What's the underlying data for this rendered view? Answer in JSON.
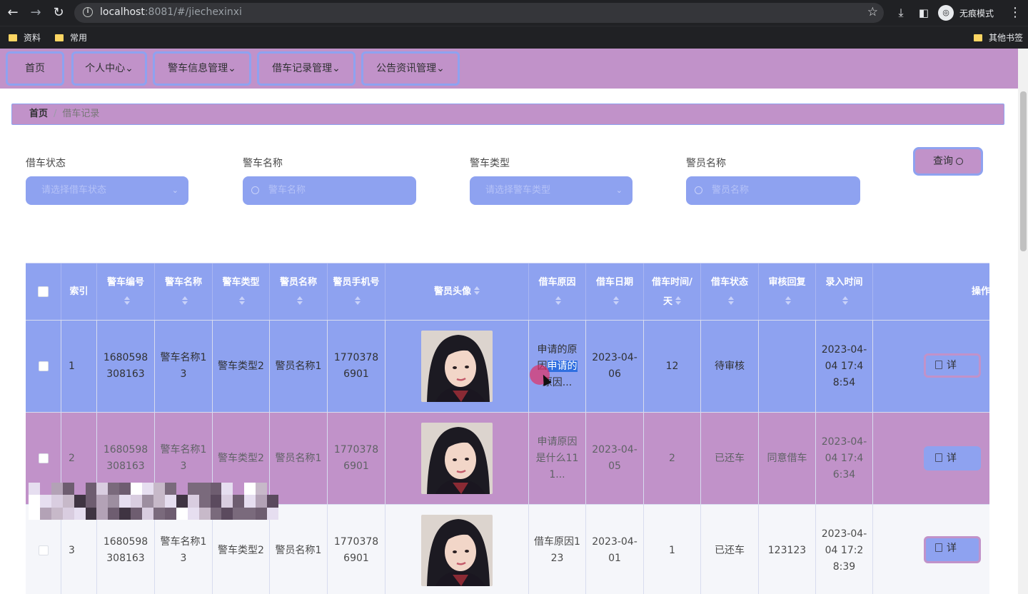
{
  "browser": {
    "url_host": "localhost",
    "url_rest": ":8081/#/jiechexinxi",
    "incognito_label": "无痕模式",
    "bookmarks": [
      "资料",
      "常用"
    ],
    "other_bookmarks": "其他书签"
  },
  "nav": {
    "items": [
      {
        "label": "首页"
      },
      {
        "label": "个人中心",
        "chevron": "⌄"
      },
      {
        "label": "警车信息管理",
        "chevron": "⌄"
      },
      {
        "label": "借车记录管理",
        "chevron": "⌄"
      },
      {
        "label": "公告资讯管理",
        "chevron": "⌄"
      }
    ]
  },
  "breadcrumb": {
    "home": "首页",
    "separator": "/",
    "current": "借车记录"
  },
  "filters": {
    "status": {
      "label": "借车状态",
      "placeholder": "请选择借车状态"
    },
    "car_name": {
      "label": "警车名称",
      "placeholder": "警车名称"
    },
    "car_type": {
      "label": "警车类型",
      "placeholder": "请选择警车类型"
    },
    "officer_name": {
      "label": "警员名称",
      "placeholder": "警员名称"
    },
    "query_label": "查询"
  },
  "table": {
    "headers": [
      "索引",
      "警车编号",
      "警车名称",
      "警车类型",
      "警员名称",
      "警员手机号",
      "警员头像",
      "借车原因",
      "借车日期",
      "借车时间/天",
      "借车状态",
      "审核回复",
      "录入时间",
      "操作"
    ],
    "rows": [
      {
        "index": "1",
        "car_no": "1680598308163",
        "car_name": "警车名称13",
        "car_type": "警车类型2",
        "officer": "警员名称1",
        "phone": "17703786901",
        "reason_a": "申请的原因",
        "reason_b": "申请的",
        "reason_c": "原因...",
        "date": "2023-04-06",
        "days": "12",
        "status": "待审核",
        "reply": "",
        "created": "2023-04-04 17:48:54",
        "action": "详"
      },
      {
        "index": "2",
        "car_no": "1680598308163",
        "car_name": "警车名称13",
        "car_type": "警车类型2",
        "officer": "警员名称1",
        "phone": "17703786901",
        "reason": "申请原因是什么111...",
        "date": "2023-04-05",
        "days": "2",
        "status": "已还车",
        "reply": "同意借车",
        "created": "2023-04-04 17:46:34",
        "action": "详"
      },
      {
        "index": "3",
        "car_no": "1680598308163",
        "car_name": "警车名称13",
        "car_type": "警车类型2",
        "officer": "警员名称1",
        "phone": "17703786901",
        "reason": "借车原因123",
        "date": "2023-04-01",
        "days": "1",
        "status": "已还车",
        "reply": "123123",
        "created": "2023-04-04 17:28:39",
        "action": "详"
      }
    ]
  },
  "colors": {
    "accent_blue": "#8ea2f0",
    "accent_purple": "#c192c9",
    "selection": "#2f6fe0"
  }
}
